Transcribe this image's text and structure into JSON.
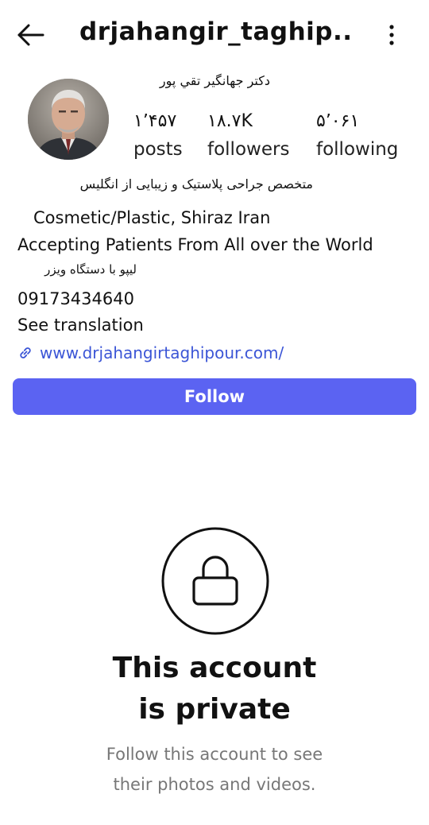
{
  "header": {
    "username": "drjahangir_taghip...",
    "back_icon": "arrow-left-icon",
    "more_icon": "more-vertical-icon"
  },
  "profile": {
    "full_name": "دکتر جهانگير تقي پور",
    "stats": {
      "posts": {
        "value": "۱٬۴۵۷",
        "label": "posts"
      },
      "followers": {
        "value": "۱۸.۷K",
        "label": "followers"
      },
      "following": {
        "value": "۵٬۰۶۱",
        "label": "following"
      }
    }
  },
  "bio": {
    "line1": "متخصص جراحی پلاستیک و زیبایی از انگلیس",
    "line2": "Cosmetic/Plastic, Shiraz Iran",
    "line3": "Accepting Patients From All over the World",
    "line4": "لیپو با دستگاه ویزر",
    "phone": "09173434640",
    "see_translation": "See translation",
    "website": "www.drjahangirtaghipour.com/"
  },
  "actions": {
    "follow_label": "Follow",
    "accent_color": "#5b63f2"
  },
  "private_notice": {
    "title_line1": "This account",
    "title_line2": "is private",
    "subtitle_line1": "Follow this account to see",
    "subtitle_line2": "their photos and videos."
  }
}
